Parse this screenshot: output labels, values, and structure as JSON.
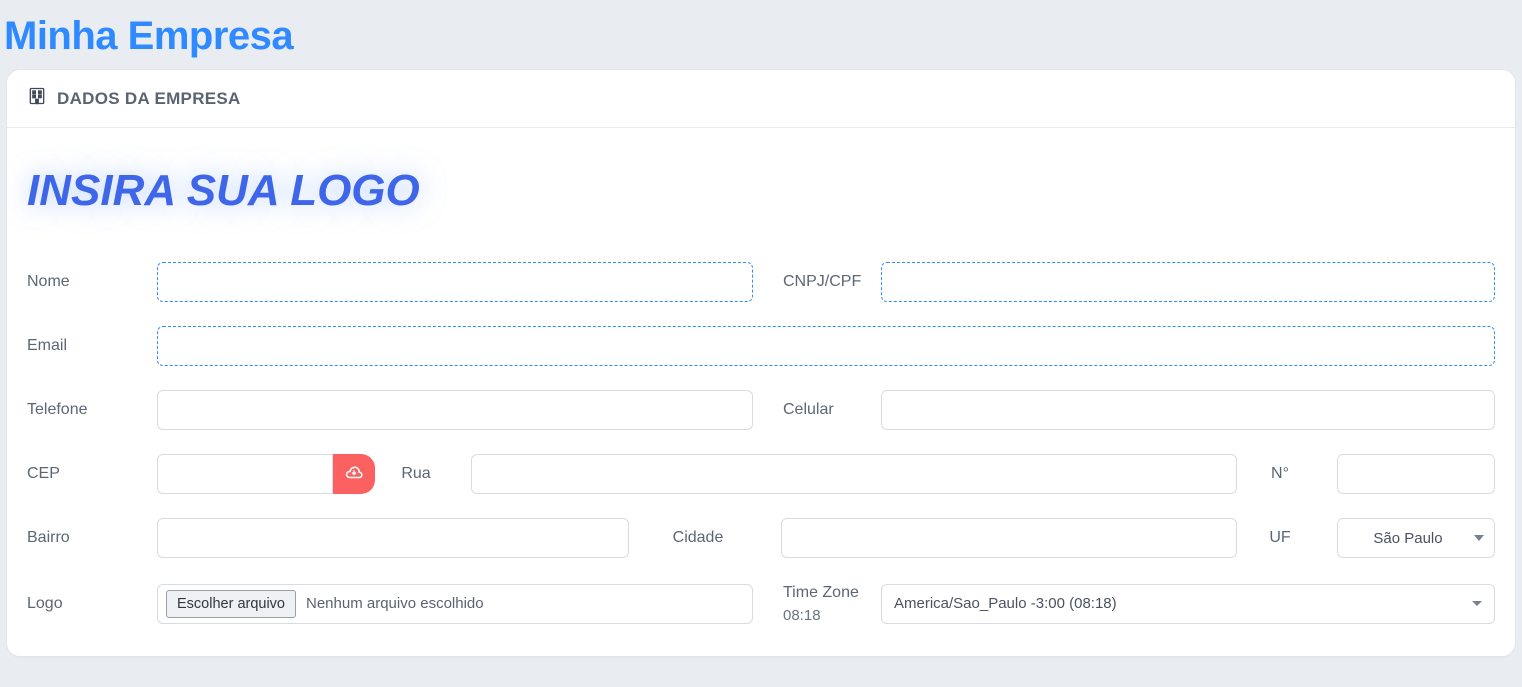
{
  "page": {
    "title": "Minha Empresa"
  },
  "card": {
    "header": "DADOS DA EMPRESA",
    "logo_placeholder": "INSIRA SUA LOGO"
  },
  "labels": {
    "nome": "Nome",
    "cnpj": "CNPJ/CPF",
    "email": "Email",
    "telefone": "Telefone",
    "celular": "Celular",
    "cep": "CEP",
    "rua": "Rua",
    "numero": "N°",
    "bairro": "Bairro",
    "cidade": "Cidade",
    "uf": "UF",
    "logo": "Logo",
    "timezone": "Time Zone",
    "timezone_time": "08:18"
  },
  "values": {
    "nome": "",
    "cnpj": "",
    "email": "",
    "telefone": "",
    "celular": "",
    "cep": "",
    "rua": "",
    "numero": "",
    "bairro": "",
    "cidade": "",
    "uf_selected": "São Paulo",
    "file_button": "Escolher arquivo",
    "file_status": "Nenhum arquivo escolhido",
    "timezone_selected": "America/Sao_Paulo -3:00 (08:18)"
  },
  "uf_options": [
    "São Paulo"
  ]
}
